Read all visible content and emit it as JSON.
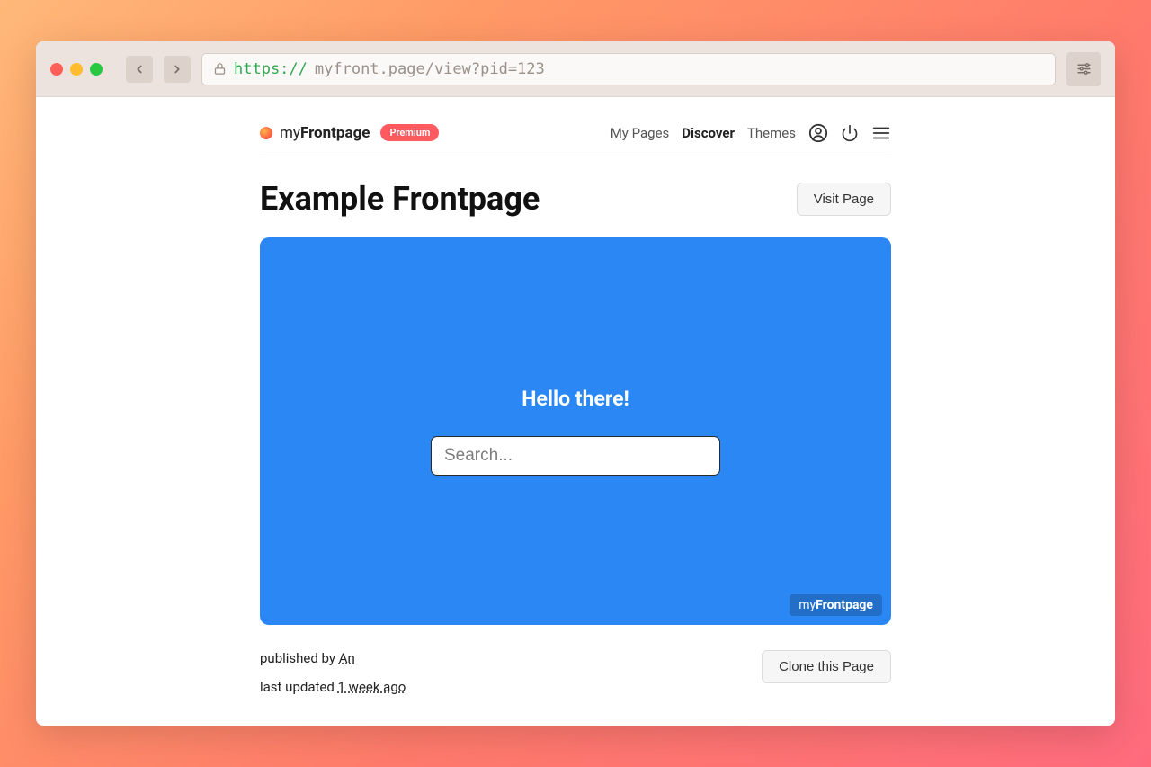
{
  "browser": {
    "url_scheme": "https://",
    "url_path": "myfront.page/view?pid=123"
  },
  "brand": {
    "name_light": "my",
    "name_bold": "Frontpage",
    "badge": "Premium"
  },
  "nav": {
    "my_pages": "My Pages",
    "discover": "Discover",
    "themes": "Themes"
  },
  "page": {
    "title": "Example Frontpage",
    "visit_button": "Visit Page",
    "clone_button": "Clone this Page"
  },
  "preview": {
    "heading": "Hello there!",
    "search_placeholder": "Search...",
    "watermark_light": "my",
    "watermark_bold": "Frontpage"
  },
  "meta": {
    "published_prefix": "published by ",
    "published_author": "An",
    "updated_prefix": "last updated ",
    "updated_value": "1 week ago"
  }
}
